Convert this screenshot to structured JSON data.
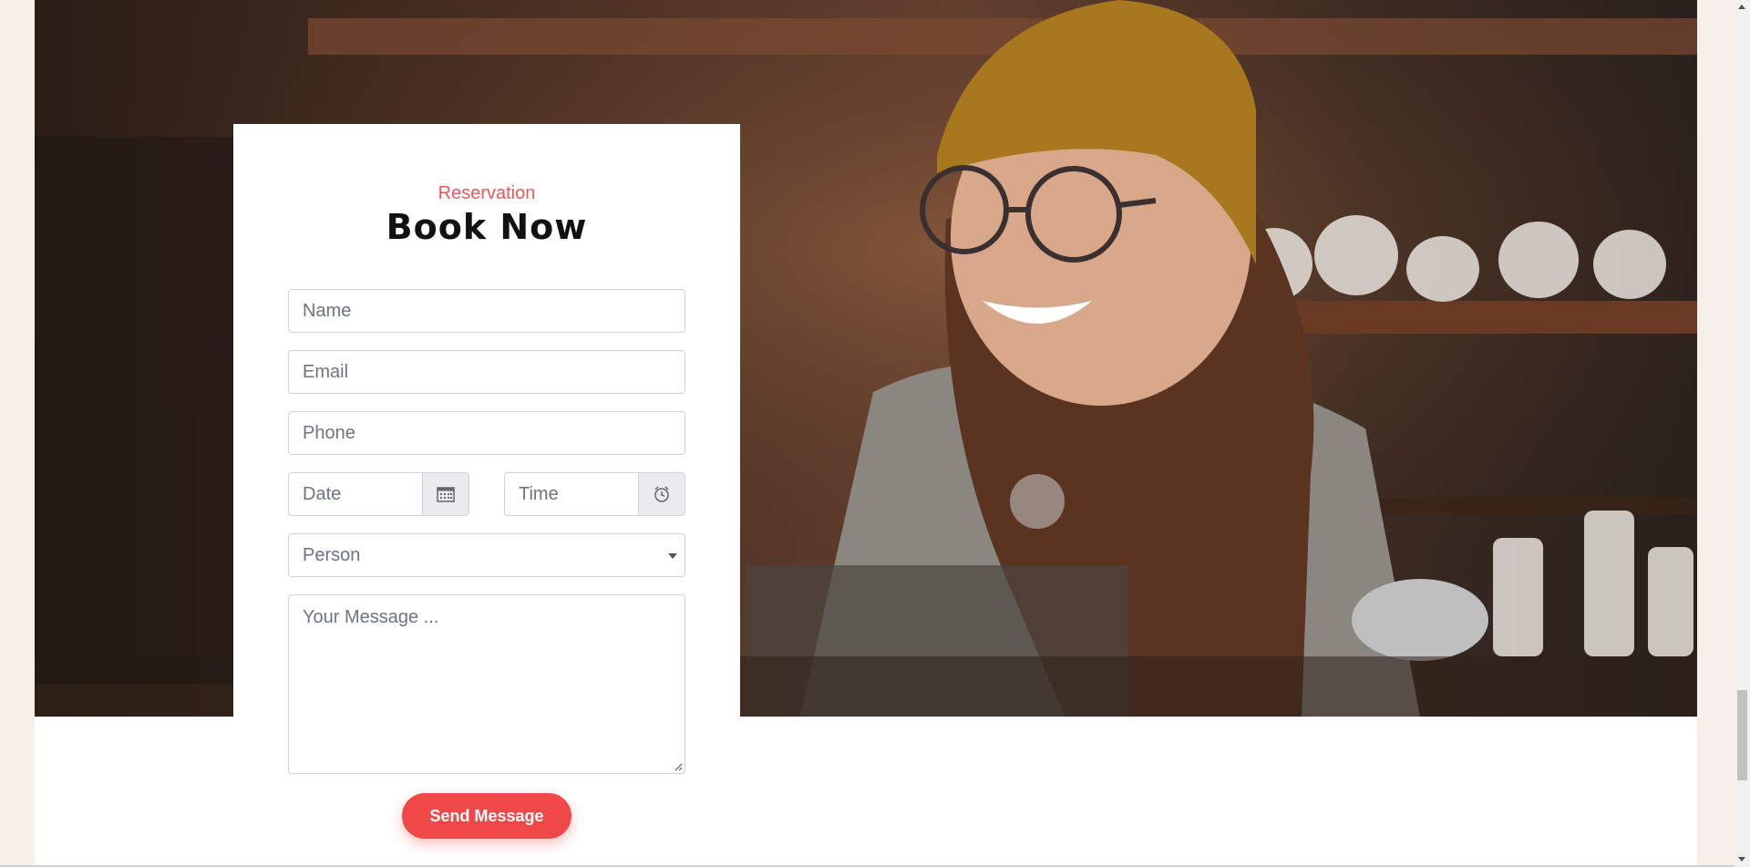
{
  "reservation": {
    "eyebrow": "Reservation",
    "title": "Book Now",
    "name_placeholder": "Name",
    "email_placeholder": "Email",
    "phone_placeholder": "Phone",
    "date_placeholder": "Date",
    "time_placeholder": "Time",
    "person_placeholder": "Person",
    "message_placeholder": "Your Message ...",
    "submit_label": "Send Message"
  },
  "colors": {
    "accent": "#f04848",
    "eyebrow": "#e8585a",
    "page_background": "#f7f0ea"
  },
  "icons": {
    "date": "calendar-icon",
    "time": "alarm-clock-icon",
    "person": "chevron-down-icon"
  }
}
